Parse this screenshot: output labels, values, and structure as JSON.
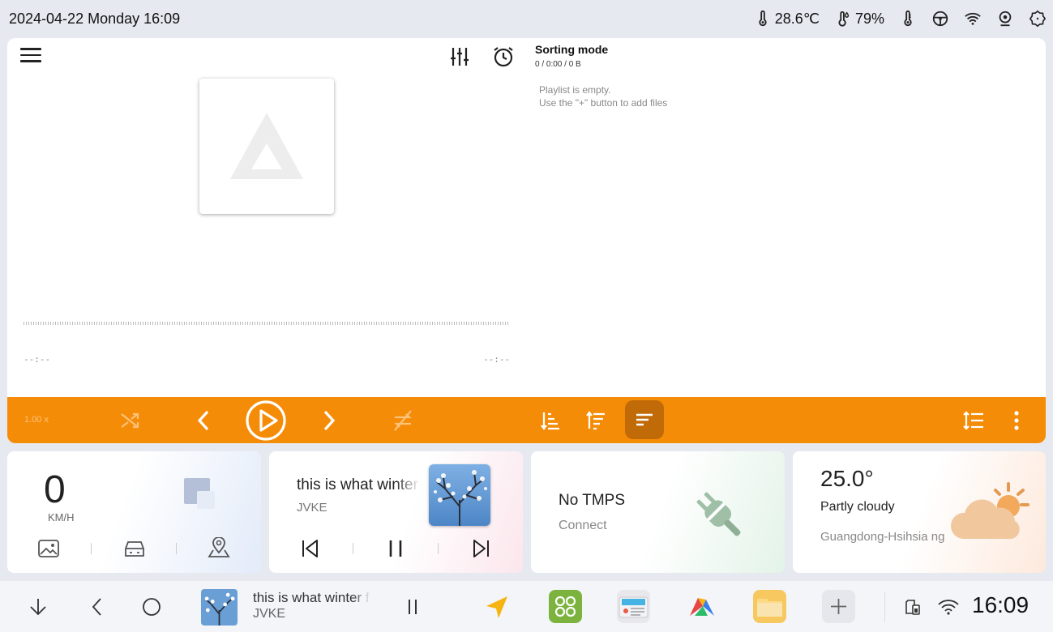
{
  "status_bar": {
    "datetime": "2024-04-22 Monday 16:09",
    "temperature": "28.6℃",
    "humidity": "79%",
    "icons": [
      "thermometer-icon",
      "humidity-icon",
      "thermometer-icon",
      "steering-wheel-icon",
      "wifi-icon",
      "camera-icon",
      "settings-icon"
    ]
  },
  "player": {
    "playlist_title": "Sorting mode",
    "playlist_stats": "0 / 0:00 / 0 B",
    "empty_line1": "Playlist is empty.",
    "empty_line2": "Use the \"+\" button to add files",
    "time_elapsed": "--:--",
    "time_total": "--:--",
    "speed": "1.00 x",
    "accent_color": "#f58c07"
  },
  "widgets": {
    "speed": {
      "value": "0",
      "unit": "KM/H"
    },
    "music": {
      "title": "this is what winter feels like",
      "artist": "JVKE"
    },
    "tpms": {
      "title": "No TMPS",
      "subtitle": "Connect"
    },
    "weather": {
      "temperature": "25.0°",
      "condition": "Partly cloudy",
      "location": "Guangdong-Hsihsia ng"
    }
  },
  "nav": {
    "song": "this is what winter feels like",
    "artist": "JVKE",
    "clock": "16:09",
    "apps": [
      "navigation-app-icon",
      "apps-grid-icon",
      "radio-app-icon",
      "maps-app-icon",
      "file-manager-icon",
      "add-app-icon"
    ]
  }
}
